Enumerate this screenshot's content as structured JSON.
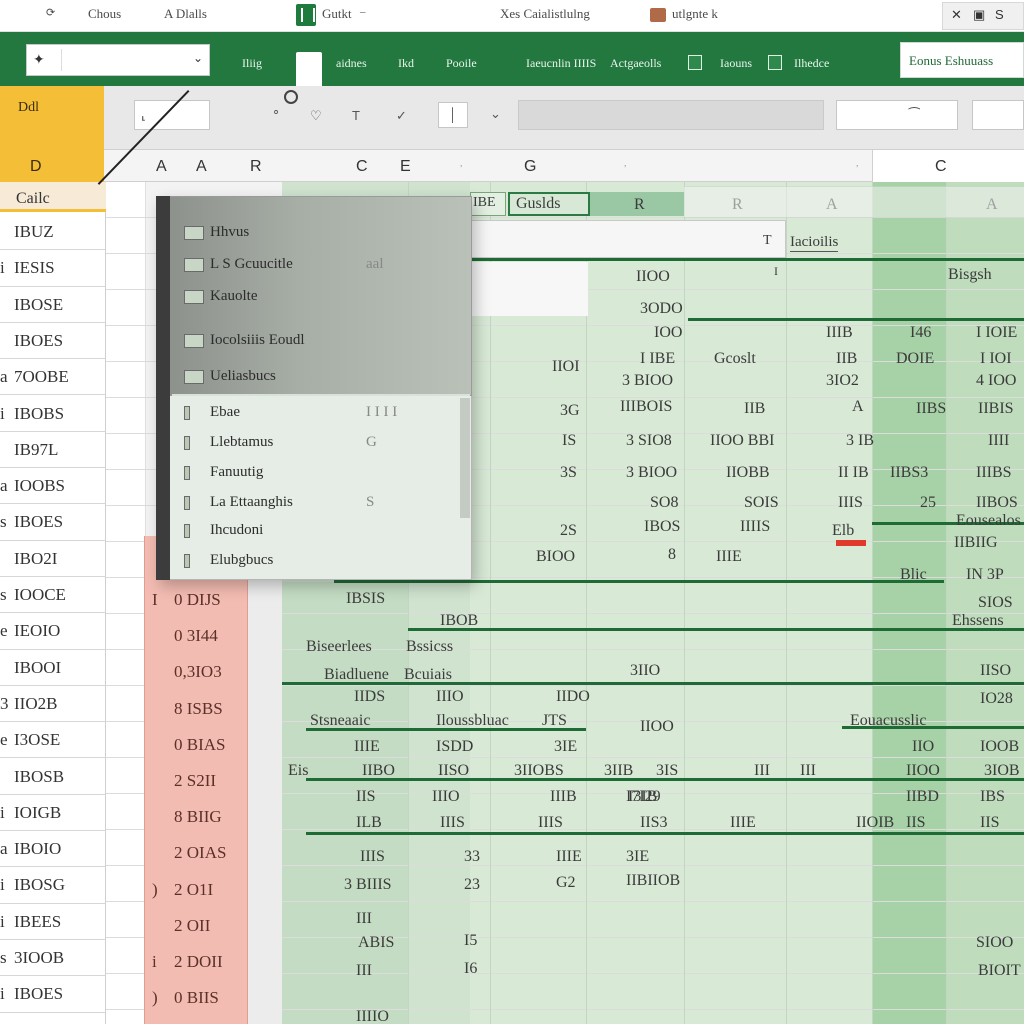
{
  "titlebar": {
    "items": [
      "Chous",
      "A Dlalls",
      "Gutkt",
      "Xes Caialistlulng",
      "utlgnte k"
    ],
    "controls": [
      "✕",
      "▣",
      "S"
    ]
  },
  "ribbon": {
    "items": [
      "Iliig",
      "aidnes",
      "Ikd",
      "Pooile",
      "Iaeucnlin IIIIS",
      "Actgaeolls",
      "Iaouns",
      "Ilhedce"
    ],
    "search_label": "Eonus Eshuuass"
  },
  "formula_bar": {
    "cell_tag_top": "Ddl",
    "cell_tag_bottom": "D",
    "glyphs": [
      "T",
      "✓"
    ]
  },
  "column_headers": [
    "A",
    "A",
    "R",
    "C",
    "E",
    "G",
    "C",
    "R",
    "A",
    "A"
  ],
  "row_header_first": "Cailc",
  "row_headers": [
    {
      "pre": "",
      "num": "IBUZ"
    },
    {
      "pre": "i",
      "num": "IESIS"
    },
    {
      "pre": "",
      "num": "IBOSE"
    },
    {
      "pre": "",
      "num": "IBOES"
    },
    {
      "pre": "a",
      "num": "7OOBE"
    },
    {
      "pre": "i",
      "num": "IBOBS"
    },
    {
      "pre": "",
      "num": "IB97L"
    },
    {
      "pre": "a",
      "num": "IOOBS"
    },
    {
      "pre": "s",
      "num": "IBOES"
    },
    {
      "pre": "",
      "num": "IBO2I"
    },
    {
      "pre": "s",
      "num": "IOOCE"
    },
    {
      "pre": "e",
      "num": "IEOIO"
    },
    {
      "pre": "",
      "num": "IBOOI"
    },
    {
      "pre": "3",
      "num": "IIO2B"
    },
    {
      "pre": "e",
      "num": "I3OSE"
    },
    {
      "pre": "",
      "num": "IBOSB"
    },
    {
      "pre": "i",
      "num": "IOIGB"
    },
    {
      "pre": "a",
      "num": "IBOIO"
    },
    {
      "pre": "i",
      "num": "IBOSG"
    },
    {
      "pre": "i",
      "num": "IBEES"
    },
    {
      "pre": "s",
      "num": "3IOOB"
    },
    {
      "pre": "i",
      "num": "IBOES"
    }
  ],
  "red_column": [
    {
      "n": "I",
      "v": "0 DIJS"
    },
    {
      "n": "",
      "v": "0 3I44"
    },
    {
      "n": "",
      "v": "0,3IO3"
    },
    {
      "n": "",
      "v": "8 ISBS"
    },
    {
      "n": "",
      "v": "0 BIAS"
    },
    {
      "n": "",
      "v": "2 S2II"
    },
    {
      "n": "",
      "v": "8 BIIG"
    },
    {
      "n": "",
      "v": "2 OIAS"
    },
    {
      "n": ")",
      "v": "2 O1I"
    },
    {
      "n": "",
      "v": "2 OII"
    },
    {
      "n": "i",
      "v": "2 DOII"
    },
    {
      "n": ")",
      "v": "0 BIIS"
    }
  ],
  "grid_header": {
    "box_a": "IBE",
    "box_b": "Guslds",
    "labels": [
      "R",
      "R",
      "A",
      "A"
    ]
  },
  "grid_tags": {
    "tag1": "Iacioilis",
    "tag2": "Bisgsh",
    "tag3": "I",
    "tag4": "T"
  },
  "context_menu": {
    "items": [
      {
        "label": "Hhvus",
        "right": ""
      },
      {
        "label": "L S Gcuucitle",
        "right": "aal"
      },
      {
        "label": "Kauolte",
        "right": ""
      },
      {
        "label": "Iocolsiiis Eoudl",
        "right": ""
      },
      {
        "label": "Ueliasbucs",
        "right": ""
      }
    ],
    "items_lower": [
      {
        "label": "Ebae",
        "right": "I I I I"
      },
      {
        "label": "Llebtamus",
        "right": "G"
      },
      {
        "label": "Fanuutig",
        "right": ""
      },
      {
        "label": "La Ettaanghis",
        "right": "S"
      },
      {
        "label": "Ihcudoni",
        "right": ""
      },
      {
        "label": "Elubgbucs",
        "right": ""
      }
    ]
  },
  "cells": [
    {
      "t": "IIOO",
      "c": "c1"
    },
    {
      "t": "3ODO",
      "c": "c2"
    },
    {
      "t": "IOO",
      "c": "c3"
    },
    {
      "t": "IIOI",
      "c": "c4"
    },
    {
      "t": "I IBE",
      "c": "c5"
    },
    {
      "t": "3 BIOO",
      "c": "c6"
    },
    {
      "t": "3G",
      "c": "c7"
    },
    {
      "t": "IIIBOIS",
      "c": "c8"
    },
    {
      "t": "IS",
      "c": "c9"
    },
    {
      "t": "3 SIO8",
      "c": "c10"
    },
    {
      "t": "3S",
      "c": "c11"
    },
    {
      "t": "3 BIOO",
      "c": "c12"
    },
    {
      "t": "SO8",
      "c": "c13"
    },
    {
      "t": "2S",
      "c": "c14"
    },
    {
      "t": "IBOS",
      "c": "c15"
    },
    {
      "t": "BIOO",
      "c": "c16"
    },
    {
      "t": "8",
      "c": "c17"
    },
    {
      "t": "Gcoslt",
      "c": "c18"
    },
    {
      "t": "IIB",
      "c": "c19"
    },
    {
      "t": "IIOO BBI",
      "c": "c20"
    },
    {
      "t": "IIOBB",
      "c": "c21"
    },
    {
      "t": "SOIS",
      "c": "c22"
    },
    {
      "t": "IIIIS",
      "c": "c23"
    },
    {
      "t": "IIIE",
      "c": "c24"
    },
    {
      "t": "IIIB",
      "c": "c25"
    },
    {
      "t": "3IO2",
      "c": "c26"
    },
    {
      "t": "IIB",
      "c": "c27"
    },
    {
      "t": "A",
      "c": "c28"
    },
    {
      "t": "3 IB",
      "c": "c29"
    },
    {
      "t": "II IB",
      "c": "c30"
    },
    {
      "t": "IIIS",
      "c": "c31"
    },
    {
      "t": "Elb",
      "c": "c32"
    },
    {
      "t": "I46",
      "c": "c33"
    },
    {
      "t": "DOIE",
      "c": "c34"
    },
    {
      "t": "IIBS",
      "c": "c35"
    },
    {
      "t": "IIBS3",
      "c": "c36"
    },
    {
      "t": "25",
      "c": "c37"
    },
    {
      "t": "I IOIE",
      "c": "c38"
    },
    {
      "t": "I IOI",
      "c": "c39"
    },
    {
      "t": "4 IOO",
      "c": "c40"
    },
    {
      "t": "IIBIS",
      "c": "c41"
    },
    {
      "t": "IIII",
      "c": "c42"
    },
    {
      "t": "IIIBS",
      "c": "c43"
    },
    {
      "t": "IIBOS",
      "c": "c44"
    },
    {
      "t": "Eousealos",
      "c": "c45"
    },
    {
      "t": "IIBIIG",
      "c": "c46"
    },
    {
      "t": "Blic",
      "c": "c47"
    },
    {
      "t": "IN 3P",
      "c": "c48"
    },
    {
      "t": "SIOS",
      "c": "c49"
    },
    {
      "t": "Ehssens",
      "c": "c50"
    },
    {
      "t": "Biseerlees",
      "c": "c51"
    },
    {
      "t": "Bssicss",
      "c": "c52"
    },
    {
      "t": "IBSIS",
      "c": "c53"
    },
    {
      "t": "IBOB",
      "c": "c54"
    },
    {
      "t": "Biadluene",
      "c": "c55"
    },
    {
      "t": "Bcuiais",
      "c": "c56"
    },
    {
      "t": "3IIO",
      "c": "c57"
    },
    {
      "t": "IISO",
      "c": "c58"
    },
    {
      "t": "IIDS",
      "c": "c59"
    },
    {
      "t": "IIIO",
      "c": "c60"
    },
    {
      "t": "IIDO",
      "c": "c61"
    },
    {
      "t": "Stsneaaic",
      "c": "c62"
    },
    {
      "t": "Iloussbluac",
      "c": "c63"
    },
    {
      "t": "JTS",
      "c": "c64"
    },
    {
      "t": "IIOO",
      "c": "c65"
    },
    {
      "t": "IO28",
      "c": "c66"
    },
    {
      "t": "Eouacusslic",
      "c": "c67"
    },
    {
      "t": "IIIE",
      "c": "c68"
    },
    {
      "t": "ISDD",
      "c": "c69"
    },
    {
      "t": "3IE",
      "c": "c70"
    },
    {
      "t": "IIO",
      "c": "c71"
    },
    {
      "t": "IOOB",
      "c": "c72"
    },
    {
      "t": "Eis",
      "c": "c73"
    },
    {
      "t": "IIBO",
      "c": "c74"
    },
    {
      "t": "IISO",
      "c": "c75"
    },
    {
      "t": "3IIOBS",
      "c": "c76"
    },
    {
      "t": "3IIB",
      "c": "c77"
    },
    {
      "t": "3IS",
      "c": "c78"
    },
    {
      "t": "III",
      "c": "c79"
    },
    {
      "t": "III",
      "c": "c80"
    },
    {
      "t": "IIOO",
      "c": "c81"
    },
    {
      "t": "3IOB",
      "c": "c82"
    },
    {
      "t": "IIS",
      "c": "c83"
    },
    {
      "t": "IIIO",
      "c": "c84"
    },
    {
      "t": "IIIB",
      "c": "c85"
    },
    {
      "t": "I3IB",
      "c": "c86"
    },
    {
      "t": "IIBD",
      "c": "c87"
    },
    {
      "t": "IBS",
      "c": "c88"
    },
    {
      "t": "I7I29",
      "c": "c89"
    },
    {
      "t": "ILB",
      "c": "c90"
    },
    {
      "t": "IIIS",
      "c": "c91"
    },
    {
      "t": "IIIS",
      "c": "c92"
    },
    {
      "t": "IIS3",
      "c": "c93"
    },
    {
      "t": "IIIE",
      "c": "c94"
    },
    {
      "t": "IIOIB",
      "c": "c95"
    },
    {
      "t": "IIS",
      "c": "c96"
    },
    {
      "t": "IIS",
      "c": "c97"
    },
    {
      "t": "G2",
      "c": "c98"
    },
    {
      "t": "33",
      "c": "c99"
    },
    {
      "t": "IIIS",
      "c": "c100"
    },
    {
      "t": "3 BIIIS",
      "c": "c101"
    },
    {
      "t": "23",
      "c": "c102"
    },
    {
      "t": "IIBIIOB",
      "c": "c103"
    },
    {
      "t": "IIIE",
      "c": "c104"
    },
    {
      "t": "3IE",
      "c": "c105"
    },
    {
      "t": "ABIS",
      "c": "c106"
    },
    {
      "t": "I5",
      "c": "c107"
    },
    {
      "t": "III",
      "c": "c108"
    },
    {
      "t": "SIOO",
      "c": "c109"
    },
    {
      "t": "III",
      "c": "c110"
    },
    {
      "t": "I6",
      "c": "c111"
    },
    {
      "t": "BIOIT",
      "c": "c112"
    },
    {
      "t": "IIIIO",
      "c": "c113"
    }
  ]
}
